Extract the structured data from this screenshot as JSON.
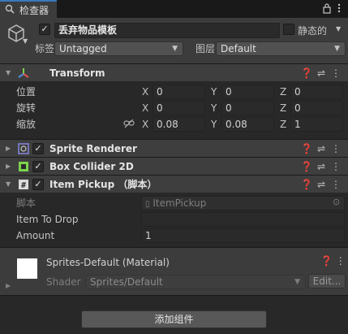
{
  "tab": {
    "title": "检查器",
    "lock_icon": "lock-icon",
    "menu_icon": "kebab-menu-icon"
  },
  "object": {
    "name": "丢弃物品模板",
    "static_label": "静态的",
    "tag_label": "标签",
    "tag_value": "Untagged",
    "layer_label": "图层",
    "layer_value": "Default"
  },
  "transform": {
    "title": "Transform",
    "position_label": "位置",
    "rotation_label": "旋转",
    "scale_label": "缩放",
    "x": "X",
    "y": "Y",
    "z": "Z",
    "position": [
      "0",
      "0",
      "0"
    ],
    "rotation": [
      "0",
      "0",
      "0"
    ],
    "scale": [
      "0.08",
      "0.08",
      "1"
    ]
  },
  "components": {
    "sprite_renderer": "Sprite Renderer",
    "box_collider": "Box Collider 2D",
    "item_pickup": "Item Pickup （脚本）"
  },
  "item_pickup": {
    "script_label": "脚本",
    "script_value": "ItemPickup",
    "item_to_drop_label": "Item To Drop",
    "item_to_drop_value": "",
    "amount_label": "Amount",
    "amount_value": "1"
  },
  "material": {
    "title": "Sprites-Default (Material)",
    "shader_label": "Shader",
    "shader_value": "Sprites/Default",
    "edit_label": "Edit..."
  },
  "add_component_label": "添加组件",
  "colors": {
    "background": "#282828",
    "header": "#3e3e3e",
    "field": "#2a2a2a",
    "button": "#585858"
  }
}
